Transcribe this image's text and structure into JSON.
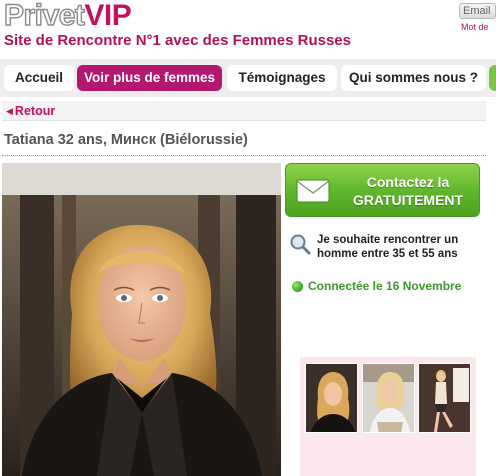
{
  "header": {
    "logo_part1": "Privet",
    "logo_part2": "VIP",
    "tagline": "Site de Rencontre N°1 avec des Femmes Russes",
    "email_button": "Email",
    "password_link": "Mot de"
  },
  "nav": {
    "tabs": [
      {
        "label": "Accueil",
        "active": false
      },
      {
        "label": "Voir plus de femmes",
        "active": true
      },
      {
        "label": "Témoignages",
        "active": false
      },
      {
        "label": "Qui sommes nous ?",
        "active": false
      }
    ]
  },
  "breadcrumb": {
    "back_label": "Retour",
    "back_icon": "left-triangle-icon"
  },
  "profile": {
    "title": "Tatiana 32 ans, Минск (Biélorussie)",
    "contact_line1": "Contactez la",
    "contact_line2": "GRATUITEMENT",
    "contact_icon": "envelope-icon",
    "seeking": "Je souhaite rencontrer un homme entre 35 et 55 ans",
    "seeking_icon": "magnifier-icon",
    "online_status": "Connectée le 16 Novembre",
    "online_icon": "green-dot-icon",
    "thumbnail_count": 3
  },
  "colors": {
    "brand_pink": "#c0135f",
    "active_tab": "#b3176e",
    "contact_green": "#5eb52a",
    "online_green": "#3a9a2a",
    "thumb_bg": "#fbe7ec"
  }
}
